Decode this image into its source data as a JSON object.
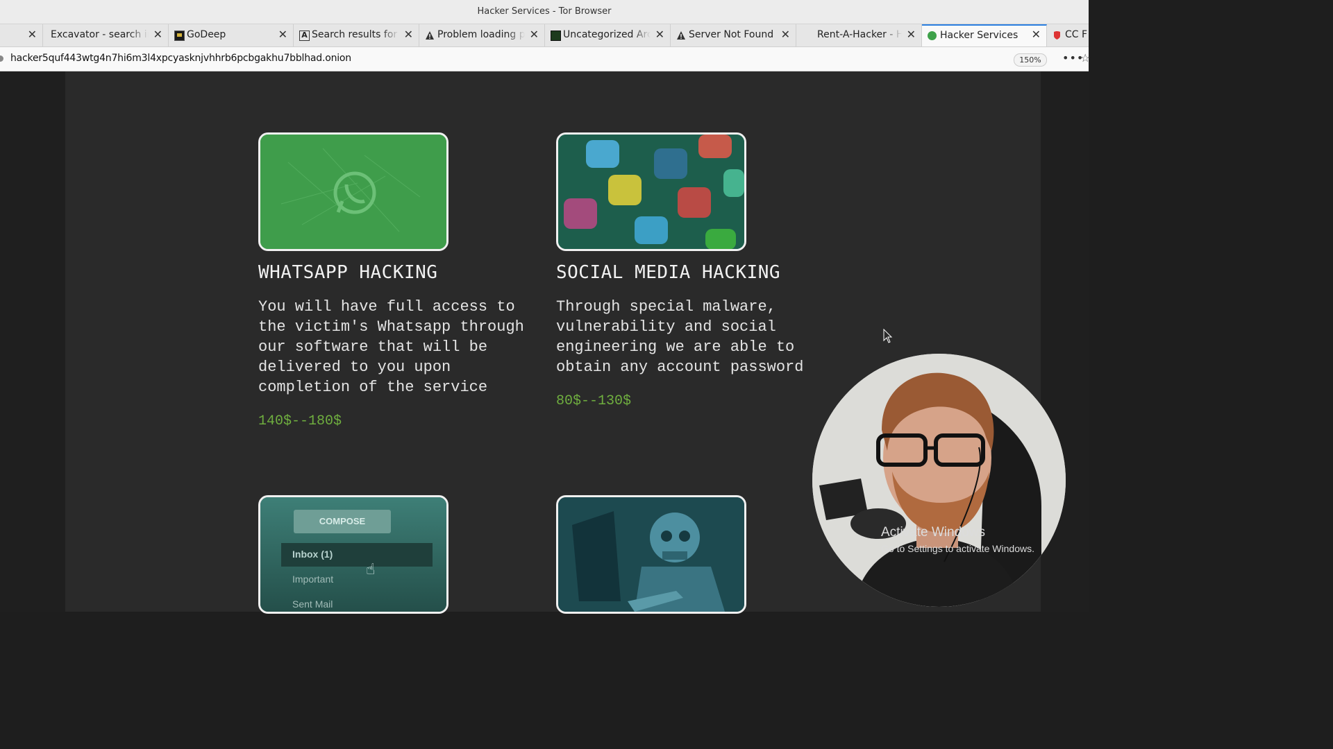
{
  "window": {
    "title": "Hacker Services - Tor Browser"
  },
  "tabs": [
    {
      "label": "",
      "icon": "blank-icon",
      "active": false
    },
    {
      "label": "Excavator - search in d",
      "icon": "blank-icon",
      "active": false
    },
    {
      "label": "GoDeep",
      "icon": "godeep-icon",
      "active": false
    },
    {
      "label": "Search results for h",
      "icon": "letter-a-icon",
      "active": false
    },
    {
      "label": "Problem loading pa",
      "icon": "warning-icon",
      "active": false
    },
    {
      "label": "Uncategorized Arch",
      "icon": "green-square-icon",
      "active": false
    },
    {
      "label": "Server Not Found",
      "icon": "warning-icon",
      "active": false
    },
    {
      "label": "Rent-A-Hacker - Hi",
      "icon": "blank-icon",
      "active": false
    },
    {
      "label": "Hacker Services",
      "icon": "green-dot-icon",
      "active": true
    },
    {
      "label": "CC F",
      "icon": "red-shield-icon",
      "active": false
    }
  ],
  "address": {
    "url": "hacker5quf443wtg4n7hi6m3l4xpcyasknjvhhrb6pcbgakhu7bblhad.onion",
    "zoom": "150%"
  },
  "services": [
    {
      "title": "WHATSAPP HACKING",
      "description": "You will have full access to the victim's Whatsapp through our software that will be delivered to you upon completion of the service",
      "price": "140$--180$",
      "image": "whatsapp-logo-image"
    },
    {
      "title": "SOCIAL MEDIA HACKING",
      "description": "Through special malware, vulnerability and social engineering we are able to obtain any account password",
      "price": "80$--130$",
      "image": "social-apps-image"
    },
    {
      "image": "email-inbox-image",
      "mock": {
        "compose": "COMPOSE",
        "inbox": "Inbox (1)",
        "important": "Important",
        "sent": "Sent Mail"
      }
    },
    {
      "image": "hacker-skeleton-image"
    }
  ],
  "overlay": {
    "activate_title": "Activate Windows",
    "activate_sub": "Go to Settings to activate Windows."
  },
  "colors": {
    "accent_price": "#6fae3f",
    "page_bg": "#2a2a2a",
    "whatsapp_green": "#3d9a48"
  }
}
